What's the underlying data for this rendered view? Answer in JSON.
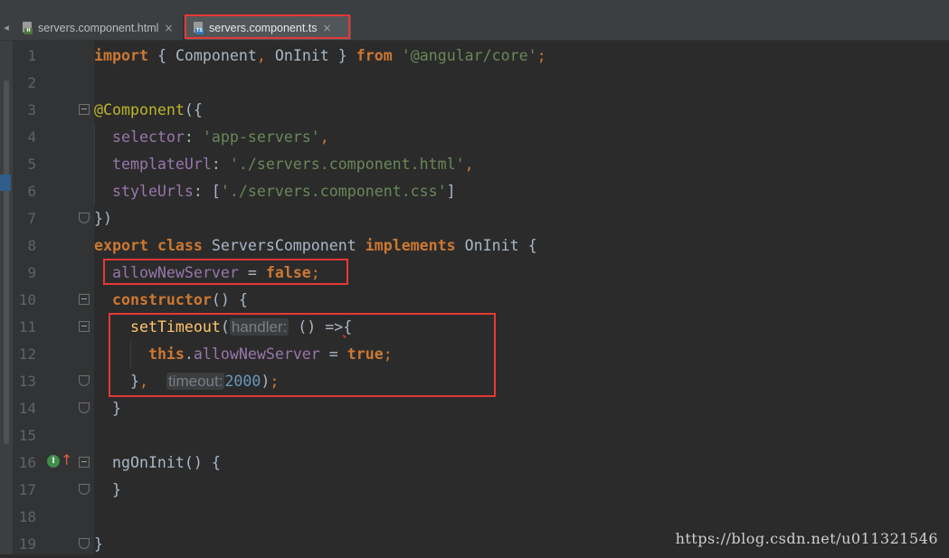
{
  "tabs": [
    {
      "label": "servers.component.html",
      "badge": "H",
      "active": false
    },
    {
      "label": "servers.component.ts",
      "badge": "TS",
      "active": true
    }
  ],
  "tab_close_glyph": "×",
  "tab_scroll_glyph": "◂",
  "line_numbers": [
    "1",
    "2",
    "3",
    "4",
    "5",
    "6",
    "7",
    "8",
    "9",
    "10",
    "11",
    "12",
    "13",
    "14",
    "15",
    "16",
    "17",
    "18",
    "19"
  ],
  "code": {
    "l1": {
      "import": "import",
      "open": " { ",
      "component": "Component",
      "comma": ",",
      "oninit": " OnInit ",
      "close": "} ",
      "from": "from",
      "space": " ",
      "module": "'@angular/core'",
      "semi": ";"
    },
    "l3": {
      "decorator": "@Component",
      "paren": "({"
    },
    "l4": {
      "key": "  selector",
      "colon": ": ",
      "value": "'app-servers'",
      "comma": ","
    },
    "l5": {
      "key": "  templateUrl",
      "colon": ": ",
      "value": "'./servers.component.html'",
      "comma": ","
    },
    "l6": {
      "key": "  styleUrls",
      "colon": ": [",
      "value": "'./servers.component.css'",
      "close": "]"
    },
    "l7": {
      "text": "})"
    },
    "l8": {
      "export": "export",
      "s1": " ",
      "class": "class",
      "name": " ServersComponent ",
      "implements": "implements",
      "iface": " OnInit {"
    },
    "l9": {
      "indent": "  ",
      "field": "allowNewServer",
      "eq": " = ",
      "value": "false",
      "semi": ";"
    },
    "l10": {
      "indent": "  ",
      "kw": "constructor",
      "rest": "() {"
    },
    "l11": {
      "indent": "    ",
      "fn": "setTimeout",
      "open": "(",
      "hint": "handler:",
      "rest": " () =>",
      "brace": "{"
    },
    "l12": {
      "indent": "      ",
      "this": "this",
      "dot": ".",
      "field": "allowNewServer",
      "eq": " = ",
      "value": "true",
      "semi": ";"
    },
    "l13": {
      "indent": "    ",
      "brace": "}",
      "comma": ",",
      "sp": "  ",
      "hint": "timeout:",
      "num": "2000",
      "close": ")",
      "semi": ";"
    },
    "l14": {
      "text": "  }"
    },
    "l16": {
      "text": "  ngOnInit() {"
    },
    "l17": {
      "text": "  }"
    },
    "l19": {
      "text": "}"
    }
  },
  "gutter_icons": {
    "implements_marker": "I",
    "override_arrow": "↑"
  },
  "watermark": "https://blog.csdn.net/u011321546",
  "colors": {
    "keyword": "#cc7832",
    "string": "#6a8759",
    "number": "#6897bb",
    "field": "#9876aa",
    "annotation": "#bbb529",
    "function": "#ffc66d",
    "highlight_box": "#e53935",
    "background": "#2b2b2b"
  }
}
